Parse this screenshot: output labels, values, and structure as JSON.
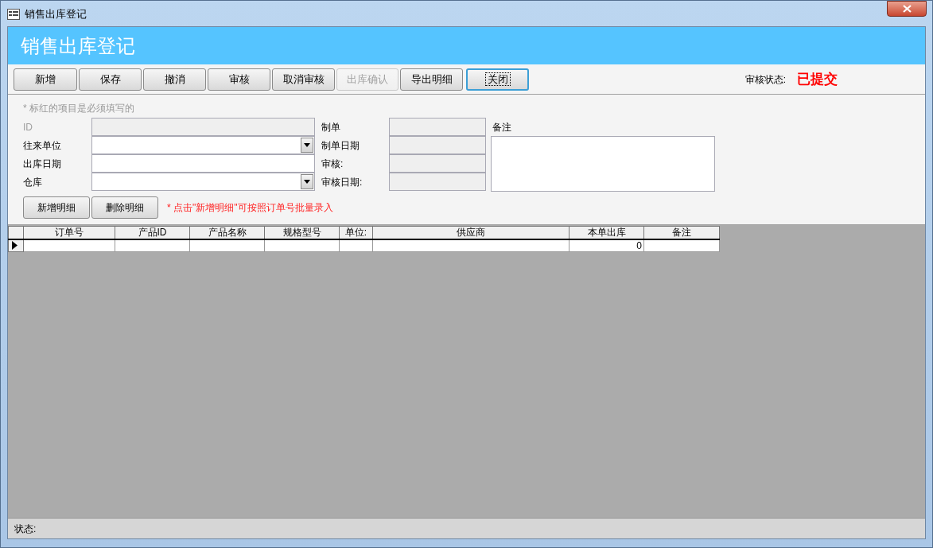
{
  "window": {
    "title": "销售出库登记"
  },
  "header": {
    "title": "销售出库登记"
  },
  "toolbar": {
    "buttons": [
      {
        "label": "新增",
        "disabled": false,
        "focused": false
      },
      {
        "label": "保存",
        "disabled": false,
        "focused": false
      },
      {
        "label": "撤消",
        "disabled": false,
        "focused": false
      },
      {
        "label": "审核",
        "disabled": false,
        "focused": false
      },
      {
        "label": "取消审核",
        "disabled": false,
        "focused": false
      },
      {
        "label": "出库确认",
        "disabled": true,
        "focused": false
      },
      {
        "label": "导出明细",
        "disabled": false,
        "focused": false
      },
      {
        "label": "关闭",
        "disabled": false,
        "focused": true
      }
    ],
    "status_label": "审核状态:",
    "status_value": "已提交"
  },
  "form": {
    "hint": "* 标红的项目是必须填写的",
    "left_fields": [
      {
        "label": "ID",
        "kind": "text",
        "disabled": true
      },
      {
        "label": "往来单位",
        "kind": "combo",
        "disabled": false
      },
      {
        "label": "出库日期",
        "kind": "text",
        "disabled": false
      },
      {
        "label": "仓库",
        "kind": "combo",
        "disabled": false
      }
    ],
    "right_fields": [
      {
        "label": "制单",
        "disabled": true
      },
      {
        "label": "制单日期",
        "disabled": true
      },
      {
        "label": "审核:",
        "disabled": true
      },
      {
        "label": "审核日期:",
        "disabled": true
      }
    ],
    "remarks_label": "备注",
    "detail_buttons": [
      "新增明细",
      "删除明细"
    ],
    "note": "* 点击\"新增明细\"可按照订单号批量录入"
  },
  "table": {
    "columns": [
      "订单号",
      "产品ID",
      "产品名称",
      "规格型号",
      "单位:",
      "供应商",
      "本单出库",
      "备注"
    ],
    "rows": [
      {
        "current": true,
        "cells": [
          "",
          "",
          "",
          "",
          "",
          "",
          "0",
          ""
        ]
      }
    ]
  },
  "status_bar": {
    "label": "状态:"
  }
}
